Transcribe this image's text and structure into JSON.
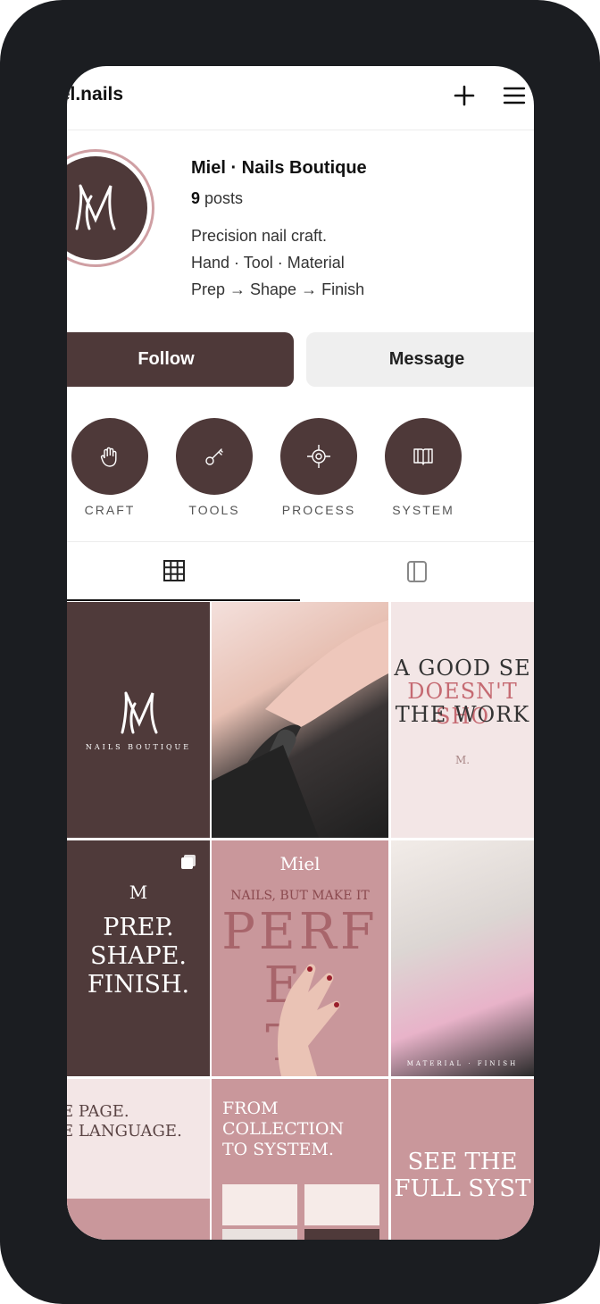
{
  "header": {
    "username": "iel.nails"
  },
  "profile": {
    "display_name": "Miel · Nails Boutique",
    "posts_count": "9",
    "posts_label": "posts",
    "bio": [
      "Precision nail craft.",
      "Hand · Tool · Material",
      "Prep → Shape → Finish"
    ]
  },
  "actions": {
    "follow_label": "Follow",
    "message_label": "Message"
  },
  "highlights": [
    {
      "label": "CRAFT",
      "icon": "hand-icon"
    },
    {
      "label": "TOOLS",
      "icon": "key-icon"
    },
    {
      "label": "PROCESS",
      "icon": "target-icon"
    },
    {
      "label": "SYSTEM",
      "icon": "book-icon"
    }
  ],
  "tabs": [
    {
      "name": "grid",
      "icon": "grid-icon",
      "active": true
    },
    {
      "name": "feed",
      "icon": "panel-icon",
      "active": false
    }
  ],
  "posts": [
    {
      "id": "logo",
      "logo": "M",
      "caption": "NAILS BOUTIQUE"
    },
    {
      "id": "photo-drill"
    },
    {
      "id": "good-set",
      "lines": [
        "A GOOD SE",
        "DOESN'T SHO",
        "THE WORK"
      ],
      "footer": "M."
    },
    {
      "id": "prep",
      "logo": "M",
      "lines": [
        "PREP.",
        "SHAPE.",
        "FINISH."
      ]
    },
    {
      "id": "perfect",
      "brand": "Miel",
      "line1": "NAILS, BUT MAKE IT",
      "big": "PERF",
      "big2": "E T"
    },
    {
      "id": "photo-gloves",
      "caption": "MATERIAL · FINISH"
    },
    {
      "id": "page",
      "lines": [
        "E PAGE.",
        "E LANGUAGE."
      ]
    },
    {
      "id": "collection",
      "lines": [
        "FROM",
        "COLLECTION",
        "TO SYSTEM."
      ]
    },
    {
      "id": "system",
      "lines": [
        "SEE THE",
        "FULL SYST"
      ]
    }
  ],
  "colors": {
    "brand": "#4e3939",
    "pink": "#c9979b",
    "blush": "#f3e6e6",
    "ring": "#cf9fa3"
  }
}
